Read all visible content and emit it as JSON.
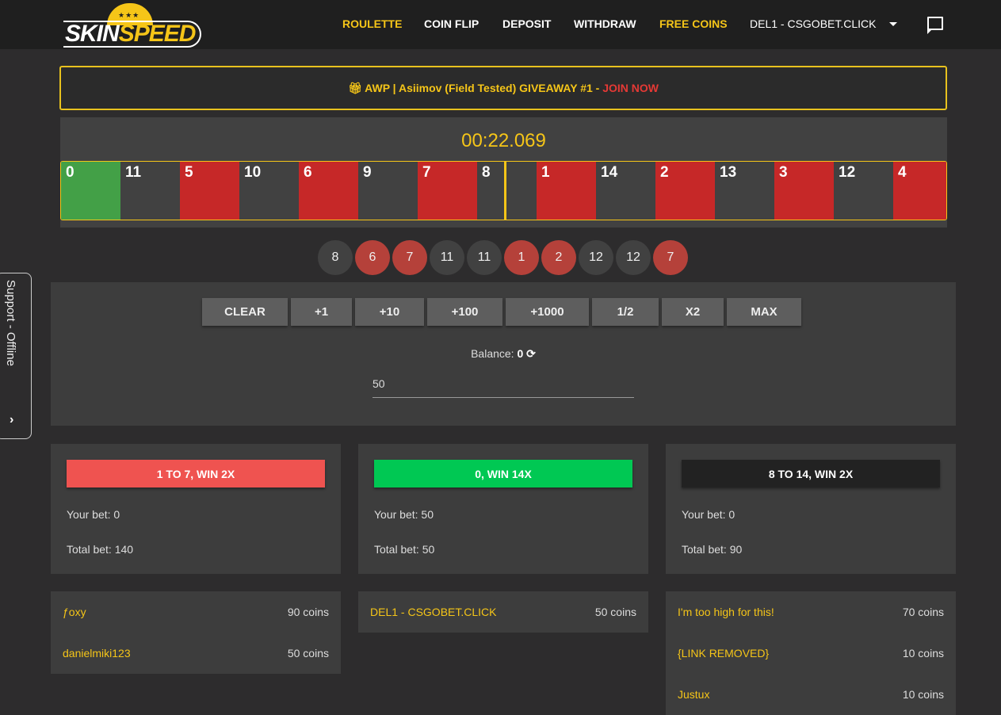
{
  "header": {
    "logo_text_white": "SKIN",
    "logo_text_yellow": "SPEED",
    "nav": [
      {
        "label": "ROULETTE",
        "highlight": true
      },
      {
        "label": "COIN FLIP",
        "highlight": false
      },
      {
        "label": "DEPOSIT",
        "highlight": false
      },
      {
        "label": "WITHDRAW",
        "highlight": false
      },
      {
        "label": "FREE COINS",
        "highlight": true
      }
    ],
    "user": "DEL1 - CSGOBET.CLICK",
    "icons": [
      "caret-down-icon",
      "chat-icon"
    ]
  },
  "colors": {
    "accent": "#f5c518",
    "red": "#c62828",
    "green": "#43a047",
    "dark": "#414141"
  },
  "giveaway": {
    "icon": "gift-icon",
    "text": "AWP | Asiimov (Field Tested) GIVEAWAY #1 - ",
    "link": "JOIN NOW"
  },
  "roulette": {
    "timer": "00:22.069",
    "cells": [
      {
        "n": "0",
        "c": "green"
      },
      {
        "n": "11",
        "c": "dark"
      },
      {
        "n": "5",
        "c": "red"
      },
      {
        "n": "10",
        "c": "dark"
      },
      {
        "n": "6",
        "c": "red"
      },
      {
        "n": "9",
        "c": "dark"
      },
      {
        "n": "7",
        "c": "red"
      },
      {
        "n": "8",
        "c": "dark"
      },
      {
        "n": "1",
        "c": "red"
      },
      {
        "n": "14",
        "c": "dark"
      },
      {
        "n": "2",
        "c": "red"
      },
      {
        "n": "13",
        "c": "dark"
      },
      {
        "n": "3",
        "c": "red"
      },
      {
        "n": "12",
        "c": "dark"
      },
      {
        "n": "4",
        "c": "red"
      }
    ],
    "history": [
      {
        "n": "8",
        "c": "dark"
      },
      {
        "n": "6",
        "c": "red"
      },
      {
        "n": "7",
        "c": "red"
      },
      {
        "n": "11",
        "c": "dark"
      },
      {
        "n": "11",
        "c": "dark"
      },
      {
        "n": "1",
        "c": "red"
      },
      {
        "n": "2",
        "c": "red"
      },
      {
        "n": "12",
        "c": "dark"
      },
      {
        "n": "12",
        "c": "dark"
      },
      {
        "n": "7",
        "c": "red"
      }
    ]
  },
  "bet": {
    "buttons": [
      "CLEAR",
      "+1",
      "+10",
      "+100",
      "+1000",
      "1/2",
      "X2",
      "MAX"
    ],
    "balance_label": "Balance: ",
    "balance": "0",
    "amount": "50"
  },
  "cards": [
    {
      "label_a": "1",
      "label_mid": " TO ",
      "label_b": "7",
      "label_end": ", WIN 2X",
      "color": "#ef5350",
      "your_bet": "Your bet: 0",
      "total_bet": "Total bet: 140",
      "bets": [
        {
          "name": "ƒoxy",
          "coins": "90 coins"
        },
        {
          "name": "danielmiki123",
          "coins": "50 coins"
        }
      ]
    },
    {
      "label_a": "0",
      "label_mid": "",
      "label_b": "",
      "label_end": ", WIN 14X",
      "color": "#00c853",
      "your_bet": "Your bet: 50",
      "total_bet": "Total bet: 50",
      "bets": [
        {
          "name": "DEL1 - CSGOBET.CLICK",
          "coins": "50 coins"
        }
      ]
    },
    {
      "label_a": "8",
      "label_mid": " TO ",
      "label_b": "14",
      "label_end": ", WIN 2X",
      "color": "#222222",
      "your_bet": "Your bet: 0",
      "total_bet": "Total bet: 90",
      "bets": [
        {
          "name": "I'm too high for this!",
          "coins": "70 coins"
        },
        {
          "name": "{LINK REMOVED}",
          "coins": "10 coins"
        },
        {
          "name": "Justux",
          "coins": "10 coins"
        }
      ]
    }
  ],
  "support": {
    "label": "Support - Offline"
  }
}
